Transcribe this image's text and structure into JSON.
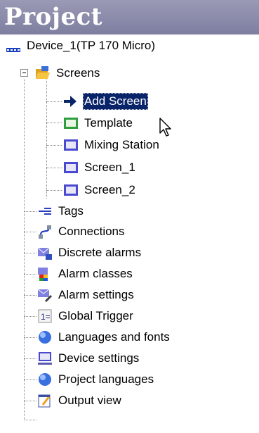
{
  "header": {
    "title": "Project"
  },
  "tree": {
    "device": {
      "label": "Device_1(TP 170 Micro)",
      "icon": "device-icon"
    },
    "screens": {
      "label": "Screens",
      "icon": "folder-open-icon",
      "children": [
        {
          "label": "Add Screen",
          "icon": "add-arrow-icon",
          "selected": true
        },
        {
          "label": "Template",
          "icon": "template-screen-icon"
        },
        {
          "label": "Mixing Station",
          "icon": "screen-icon"
        },
        {
          "label": "Screen_1",
          "icon": "screen-icon"
        },
        {
          "label": "Screen_2",
          "icon": "screen-icon"
        }
      ]
    },
    "items": [
      {
        "label": "Tags",
        "icon": "tags-icon"
      },
      {
        "label": "Connections",
        "icon": "connections-icon"
      },
      {
        "label": "Discrete alarms",
        "icon": "discrete-alarms-icon"
      },
      {
        "label": "Alarm classes",
        "icon": "alarm-classes-icon"
      },
      {
        "label": "Alarm settings",
        "icon": "alarm-settings-icon"
      },
      {
        "label": "Global Trigger",
        "icon": "global-trigger-icon"
      },
      {
        "label": "Languages and fonts",
        "icon": "globe-icon"
      },
      {
        "label": "Device settings",
        "icon": "monitor-icon"
      },
      {
        "label": "Project languages",
        "icon": "globe-icon"
      },
      {
        "label": "Output view",
        "icon": "output-view-icon"
      }
    ]
  },
  "colors": {
    "header": "#8b8bab",
    "selection": "#0a246a"
  }
}
